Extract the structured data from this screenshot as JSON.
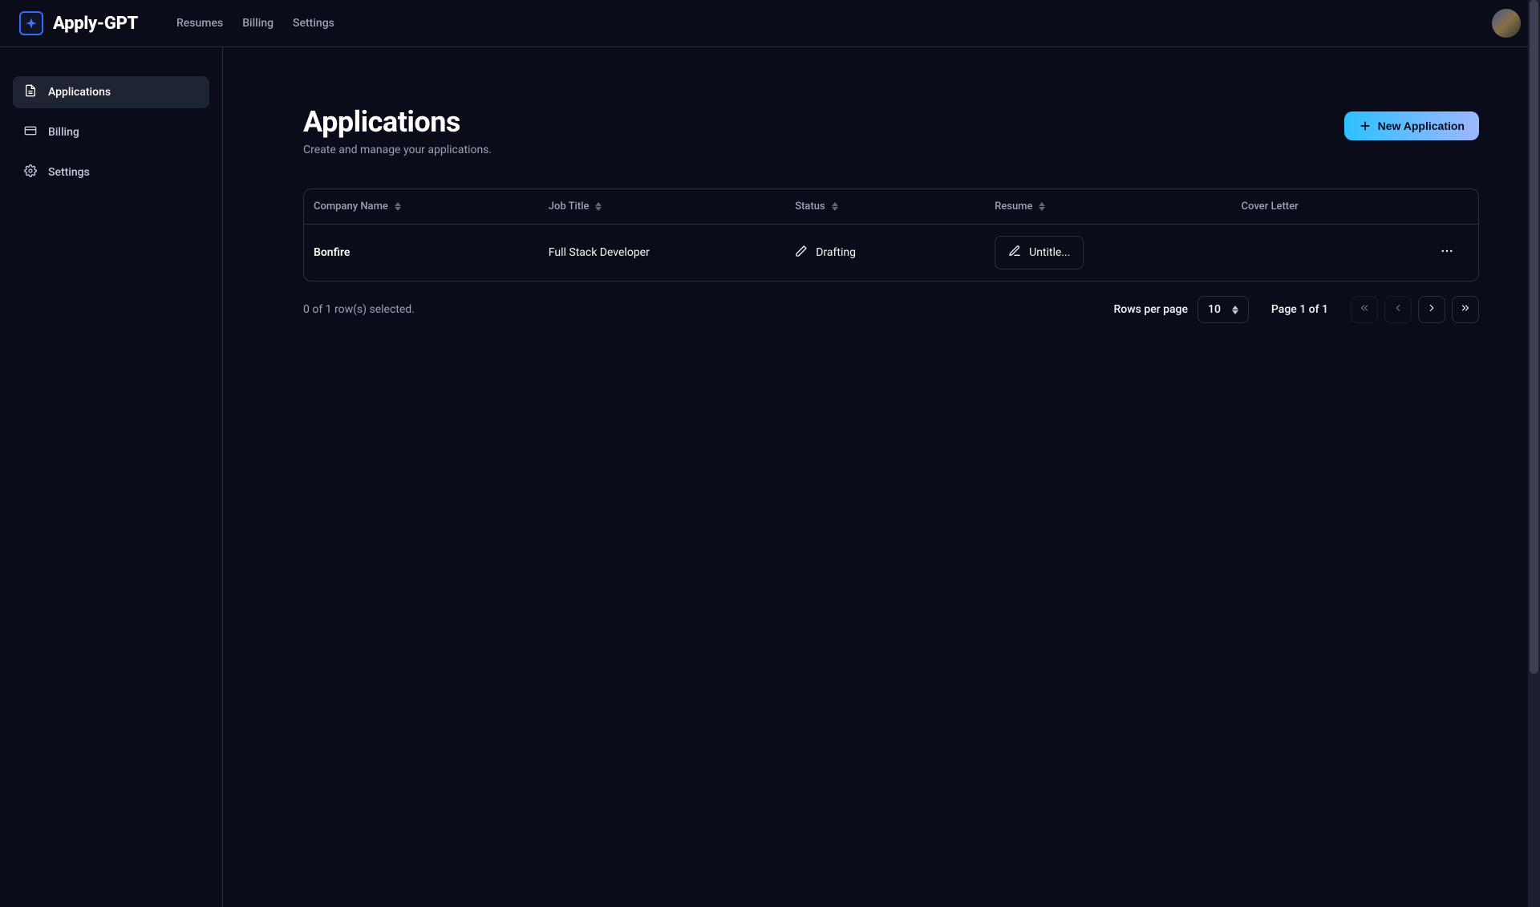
{
  "brand": {
    "name": "Apply-GPT"
  },
  "topnav": {
    "links": [
      "Resumes",
      "Billing",
      "Settings"
    ]
  },
  "sidebar": {
    "items": [
      {
        "label": "Applications",
        "icon": "file-text-icon",
        "active": true
      },
      {
        "label": "Billing",
        "icon": "credit-card-icon",
        "active": false
      },
      {
        "label": "Settings",
        "icon": "gear-icon",
        "active": false
      }
    ]
  },
  "page": {
    "title": "Applications",
    "subtitle": "Create and manage your applications.",
    "new_button": "New Application"
  },
  "table": {
    "columns": {
      "company": "Company Name",
      "job_title": "Job Title",
      "status": "Status",
      "resume": "Resume",
      "cover_letter": "Cover Letter"
    },
    "rows": [
      {
        "company": "Bonfire",
        "job_title": "Full Stack Developer",
        "status": "Drafting",
        "resume": "Untitle...",
        "cover_letter": ""
      }
    ]
  },
  "footer": {
    "selection": "0 of 1 row(s) selected.",
    "rows_per_page_label": "Rows per page",
    "rows_per_page_value": "10",
    "page_info": "Page 1 of 1"
  }
}
